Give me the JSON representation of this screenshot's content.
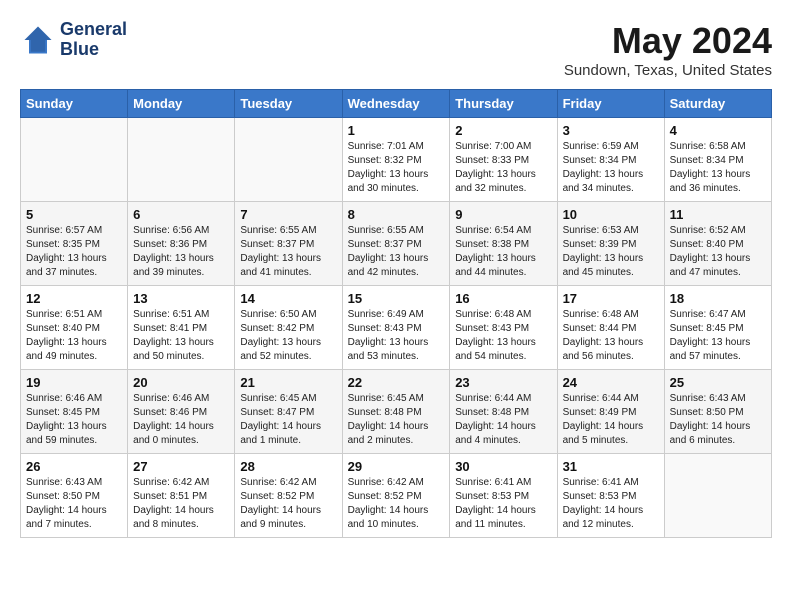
{
  "header": {
    "logo_line1": "General",
    "logo_line2": "Blue",
    "month_year": "May 2024",
    "location": "Sundown, Texas, United States"
  },
  "weekdays": [
    "Sunday",
    "Monday",
    "Tuesday",
    "Wednesday",
    "Thursday",
    "Friday",
    "Saturday"
  ],
  "weeks": [
    [
      {
        "day": "",
        "info": ""
      },
      {
        "day": "",
        "info": ""
      },
      {
        "day": "",
        "info": ""
      },
      {
        "day": "1",
        "info": "Sunrise: 7:01 AM\nSunset: 8:32 PM\nDaylight: 13 hours\nand 30 minutes."
      },
      {
        "day": "2",
        "info": "Sunrise: 7:00 AM\nSunset: 8:33 PM\nDaylight: 13 hours\nand 32 minutes."
      },
      {
        "day": "3",
        "info": "Sunrise: 6:59 AM\nSunset: 8:34 PM\nDaylight: 13 hours\nand 34 minutes."
      },
      {
        "day": "4",
        "info": "Sunrise: 6:58 AM\nSunset: 8:34 PM\nDaylight: 13 hours\nand 36 minutes."
      }
    ],
    [
      {
        "day": "5",
        "info": "Sunrise: 6:57 AM\nSunset: 8:35 PM\nDaylight: 13 hours\nand 37 minutes."
      },
      {
        "day": "6",
        "info": "Sunrise: 6:56 AM\nSunset: 8:36 PM\nDaylight: 13 hours\nand 39 minutes."
      },
      {
        "day": "7",
        "info": "Sunrise: 6:55 AM\nSunset: 8:37 PM\nDaylight: 13 hours\nand 41 minutes."
      },
      {
        "day": "8",
        "info": "Sunrise: 6:55 AM\nSunset: 8:37 PM\nDaylight: 13 hours\nand 42 minutes."
      },
      {
        "day": "9",
        "info": "Sunrise: 6:54 AM\nSunset: 8:38 PM\nDaylight: 13 hours\nand 44 minutes."
      },
      {
        "day": "10",
        "info": "Sunrise: 6:53 AM\nSunset: 8:39 PM\nDaylight: 13 hours\nand 45 minutes."
      },
      {
        "day": "11",
        "info": "Sunrise: 6:52 AM\nSunset: 8:40 PM\nDaylight: 13 hours\nand 47 minutes."
      }
    ],
    [
      {
        "day": "12",
        "info": "Sunrise: 6:51 AM\nSunset: 8:40 PM\nDaylight: 13 hours\nand 49 minutes."
      },
      {
        "day": "13",
        "info": "Sunrise: 6:51 AM\nSunset: 8:41 PM\nDaylight: 13 hours\nand 50 minutes."
      },
      {
        "day": "14",
        "info": "Sunrise: 6:50 AM\nSunset: 8:42 PM\nDaylight: 13 hours\nand 52 minutes."
      },
      {
        "day": "15",
        "info": "Sunrise: 6:49 AM\nSunset: 8:43 PM\nDaylight: 13 hours\nand 53 minutes."
      },
      {
        "day": "16",
        "info": "Sunrise: 6:48 AM\nSunset: 8:43 PM\nDaylight: 13 hours\nand 54 minutes."
      },
      {
        "day": "17",
        "info": "Sunrise: 6:48 AM\nSunset: 8:44 PM\nDaylight: 13 hours\nand 56 minutes."
      },
      {
        "day": "18",
        "info": "Sunrise: 6:47 AM\nSunset: 8:45 PM\nDaylight: 13 hours\nand 57 minutes."
      }
    ],
    [
      {
        "day": "19",
        "info": "Sunrise: 6:46 AM\nSunset: 8:45 PM\nDaylight: 13 hours\nand 59 minutes."
      },
      {
        "day": "20",
        "info": "Sunrise: 6:46 AM\nSunset: 8:46 PM\nDaylight: 14 hours\nand 0 minutes."
      },
      {
        "day": "21",
        "info": "Sunrise: 6:45 AM\nSunset: 8:47 PM\nDaylight: 14 hours\nand 1 minute."
      },
      {
        "day": "22",
        "info": "Sunrise: 6:45 AM\nSunset: 8:48 PM\nDaylight: 14 hours\nand 2 minutes."
      },
      {
        "day": "23",
        "info": "Sunrise: 6:44 AM\nSunset: 8:48 PM\nDaylight: 14 hours\nand 4 minutes."
      },
      {
        "day": "24",
        "info": "Sunrise: 6:44 AM\nSunset: 8:49 PM\nDaylight: 14 hours\nand 5 minutes."
      },
      {
        "day": "25",
        "info": "Sunrise: 6:43 AM\nSunset: 8:50 PM\nDaylight: 14 hours\nand 6 minutes."
      }
    ],
    [
      {
        "day": "26",
        "info": "Sunrise: 6:43 AM\nSunset: 8:50 PM\nDaylight: 14 hours\nand 7 minutes."
      },
      {
        "day": "27",
        "info": "Sunrise: 6:42 AM\nSunset: 8:51 PM\nDaylight: 14 hours\nand 8 minutes."
      },
      {
        "day": "28",
        "info": "Sunrise: 6:42 AM\nSunset: 8:52 PM\nDaylight: 14 hours\nand 9 minutes."
      },
      {
        "day": "29",
        "info": "Sunrise: 6:42 AM\nSunset: 8:52 PM\nDaylight: 14 hours\nand 10 minutes."
      },
      {
        "day": "30",
        "info": "Sunrise: 6:41 AM\nSunset: 8:53 PM\nDaylight: 14 hours\nand 11 minutes."
      },
      {
        "day": "31",
        "info": "Sunrise: 6:41 AM\nSunset: 8:53 PM\nDaylight: 14 hours\nand 12 minutes."
      },
      {
        "day": "",
        "info": ""
      }
    ]
  ]
}
